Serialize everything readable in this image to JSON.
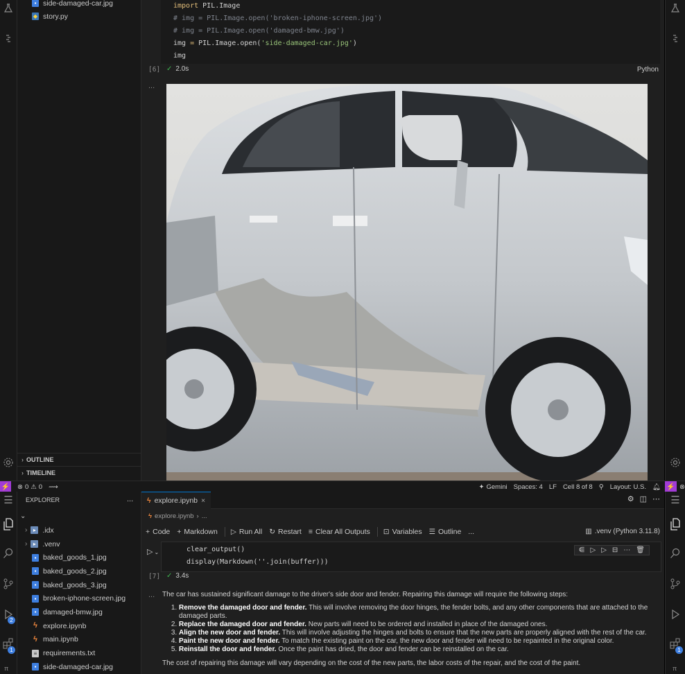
{
  "top_window": {
    "sidebar_partial_items": [
      {
        "icon": "image-file-icon",
        "label": "side-damaged-car.jpg"
      },
      {
        "icon": "python-file-icon",
        "label": "story.py"
      }
    ],
    "outline_label": "OUTLINE",
    "timeline_label": "TIMELINE",
    "code_lines": [
      {
        "parts": [
          {
            "t": "import ",
            "c": "kw"
          },
          {
            "t": "PIL",
            "c": ""
          },
          {
            "t": ".Image",
            "c": ""
          }
        ]
      },
      {
        "parts": [
          {
            "t": "# img = PIL.Image.open('broken-iphone-screen.jpg')",
            "c": "cm"
          }
        ]
      },
      {
        "parts": [
          {
            "t": "# img = PIL.Image.open('damaged-bmw.jpg')",
            "c": "cm"
          }
        ]
      },
      {
        "parts": [
          {
            "t": "img ",
            "c": ""
          },
          {
            "t": "= ",
            "c": "kw"
          },
          {
            "t": "PIL",
            "c": ""
          },
          {
            "t": ".Image.open(",
            "c": ""
          },
          {
            "t": "'side-damaged-car.jpg'",
            "c": "str"
          },
          {
            "t": ")",
            "c": ""
          }
        ]
      },
      {
        "parts": [
          {
            "t": "img",
            "c": ""
          }
        ]
      }
    ],
    "exec_count": "[6]",
    "exec_time": "2.0s",
    "language": "Python",
    "output_ellipsis": "...",
    "status": {
      "errors": "0",
      "warnings": "0",
      "gemini": "Gemini",
      "spaces": "Spaces: 4",
      "eol": "LF",
      "cell": "Cell 8 of 8",
      "layout": "Layout: U.S."
    }
  },
  "bottom_window": {
    "explorer_title": "EXPLORER",
    "explorer_menu": "...",
    "tree": [
      {
        "label": ".idx",
        "kind": "folder"
      },
      {
        "label": ".venv",
        "kind": "folder"
      },
      {
        "label": "baked_goods_1.jpg",
        "kind": "image"
      },
      {
        "label": "baked_goods_2.jpg",
        "kind": "image"
      },
      {
        "label": "baked_goods_3.jpg",
        "kind": "image"
      },
      {
        "label": "broken-iphone-screen.jpg",
        "kind": "image"
      },
      {
        "label": "damaged-bmw.jpg",
        "kind": "image"
      },
      {
        "label": "explore.ipynb",
        "kind": "notebook"
      },
      {
        "label": "main.ipynb",
        "kind": "notebook"
      },
      {
        "label": "requirements.txt",
        "kind": "text"
      },
      {
        "label": "side-damaged-car.jpg",
        "kind": "image"
      }
    ],
    "tab_label": "explore.ipynb",
    "breadcrumb": "explore.ipynb",
    "breadcrumb_more": "...",
    "toolbar": {
      "code": "Code",
      "markdown": "Markdown",
      "run_all": "Run All",
      "restart": "Restart",
      "clear_outputs": "Clear All Outputs",
      "variables": "Variables",
      "outline": "Outline",
      "more": "..."
    },
    "kernel": ".venv (Python 3.11.8)",
    "code_lines": [
      "clear_output()",
      "display(Markdown(''.join(buffer)))"
    ],
    "exec_count": "[7]",
    "exec_time": "3.4s",
    "output": {
      "intro": "The car has sustained significant damage to the driver's side door and fender. Repairing this damage will require the following steps:",
      "steps": [
        {
          "bold": "Remove the damaged door and fender.",
          "rest": " This will involve removing the door hinges, the fender bolts, and any other components that are attached to the damaged parts."
        },
        {
          "bold": "Replace the damaged door and fender.",
          "rest": " New parts will need to be ordered and installed in place of the damaged ones."
        },
        {
          "bold": "Align the new door and fender.",
          "rest": " This will involve adjusting the hinges and bolts to ensure that the new parts are properly aligned with the rest of the car."
        },
        {
          "bold": "Paint the new door and fender.",
          "rest": " To match the existing paint on the car, the new door and fender will need to be repainted in the original color."
        },
        {
          "bold": "Reinstall the door and fender.",
          "rest": " Once the paint has dried, the door and fender can be reinstalled on the car."
        }
      ],
      "outro": "The cost of repairing this damage will vary depending on the cost of the new parts, the labor costs of the repair, and the cost of the paint."
    },
    "badges": {
      "run": "2",
      "extensions": "1",
      "right": "1"
    }
  }
}
